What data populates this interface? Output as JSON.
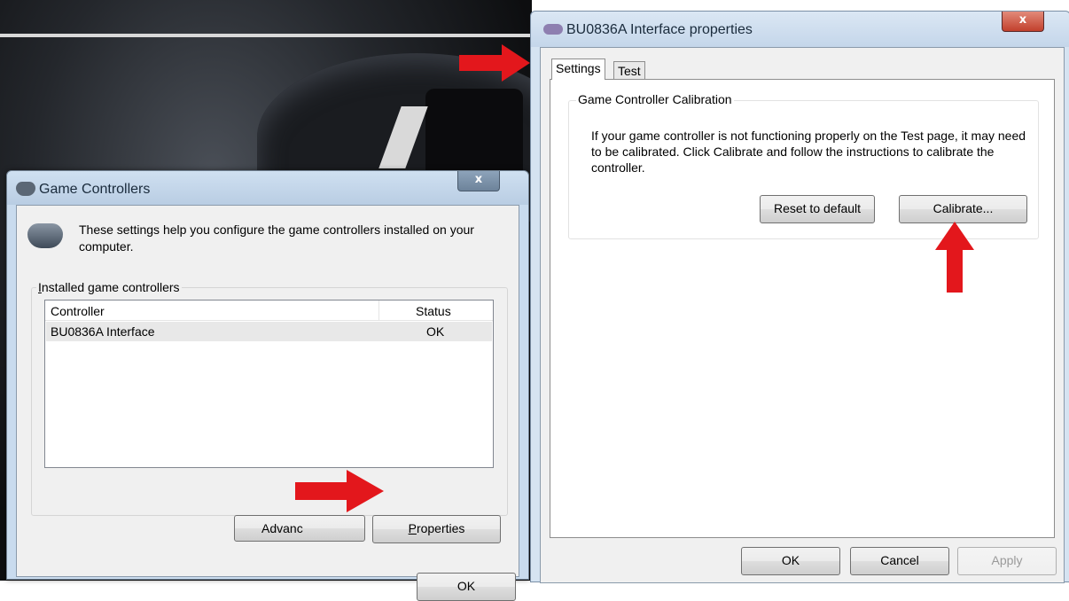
{
  "game_controllers": {
    "title": "Game Controllers",
    "close_glyph": "x",
    "intro": "These settings help you configure the game controllers installed on your computer.",
    "group_label_prefix": "I",
    "group_label_rest": "nstalled game controllers",
    "columns": [
      "Controller",
      "Status"
    ],
    "rows": [
      {
        "controller": "BU0836A Interface",
        "status": "OK"
      }
    ],
    "advanced_label": "Advanc",
    "properties_label_prefix": "P",
    "properties_label_rest": "roperties",
    "ok_label": "OK"
  },
  "interface_properties": {
    "title": "BU0836A Interface properties",
    "close_glyph": "x",
    "tabs": [
      "Settings",
      "Test"
    ],
    "active_tab": "Settings",
    "group_label": "Game Controller Calibration",
    "description": "If your game controller is not functioning properly on the Test page, it may need to be calibrated.  Click Calibrate and follow the instructions to calibrate the controller.",
    "reset_label": "Reset to default",
    "calibrate_label": "Calibrate...",
    "ok_label": "OK",
    "cancel_label": "Cancel",
    "apply_label": "Apply"
  },
  "annotations": {
    "arrow_color": "#e3171c"
  }
}
